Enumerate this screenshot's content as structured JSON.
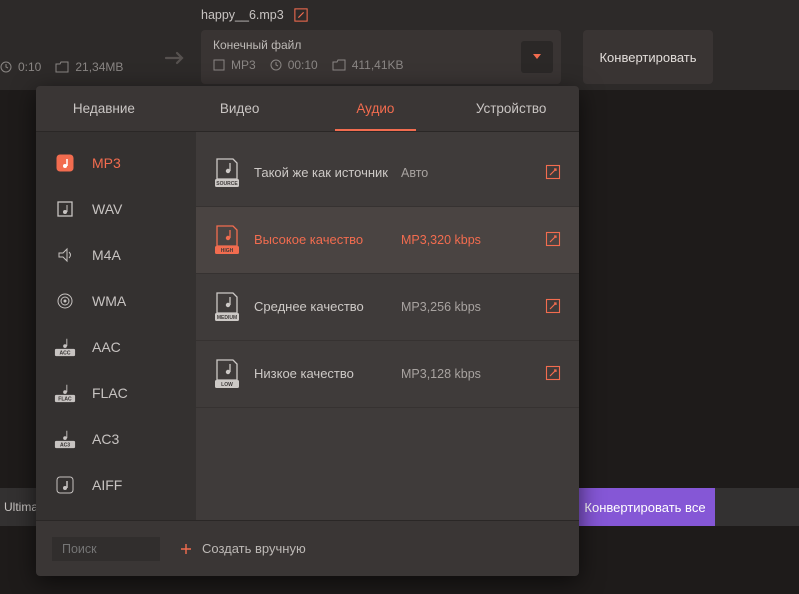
{
  "colors": {
    "accent": "#f26c4f",
    "violet": "#8557d6"
  },
  "file": {
    "name": "happy__6.mp3"
  },
  "source": {
    "duration": "0:10",
    "size": "21,34MB"
  },
  "dest": {
    "title": "Конечный файл",
    "format": "MP3",
    "duration": "00:10",
    "size": "411,41KB"
  },
  "convert_label": "Конвертировать",
  "ultima_label": "Ultima",
  "convert_all_label": "Конвертировать все",
  "tabs": [
    {
      "label": "Недавние"
    },
    {
      "label": "Видео"
    },
    {
      "label": "Аудио"
    },
    {
      "label": "Устройство"
    }
  ],
  "active_tab": 2,
  "formats": [
    {
      "code": "MP3",
      "icon": "note"
    },
    {
      "code": "WAV",
      "icon": "note-box"
    },
    {
      "code": "M4A",
      "icon": "sound"
    },
    {
      "code": "WMA",
      "icon": "spiral"
    },
    {
      "code": "AAC",
      "icon": "badge-acc"
    },
    {
      "code": "FLAC",
      "icon": "badge-flac"
    },
    {
      "code": "AC3",
      "icon": "badge-ac3"
    },
    {
      "code": "AIFF",
      "icon": "note"
    }
  ],
  "active_format": 0,
  "presets": [
    {
      "name": "Такой же как источник",
      "info": "Авто",
      "badge": "SOURCE"
    },
    {
      "name": "Высокое качество",
      "info": "MP3,320 kbps",
      "badge": "HIGH"
    },
    {
      "name": "Среднее качество",
      "info": "MP3,256 kbps",
      "badge": "MEDIUM"
    },
    {
      "name": "Низкое качество",
      "info": "MP3,128 kbps",
      "badge": "LOW"
    }
  ],
  "active_preset": 1,
  "search_placeholder": "Поиск",
  "create_label": "Создать вручную"
}
